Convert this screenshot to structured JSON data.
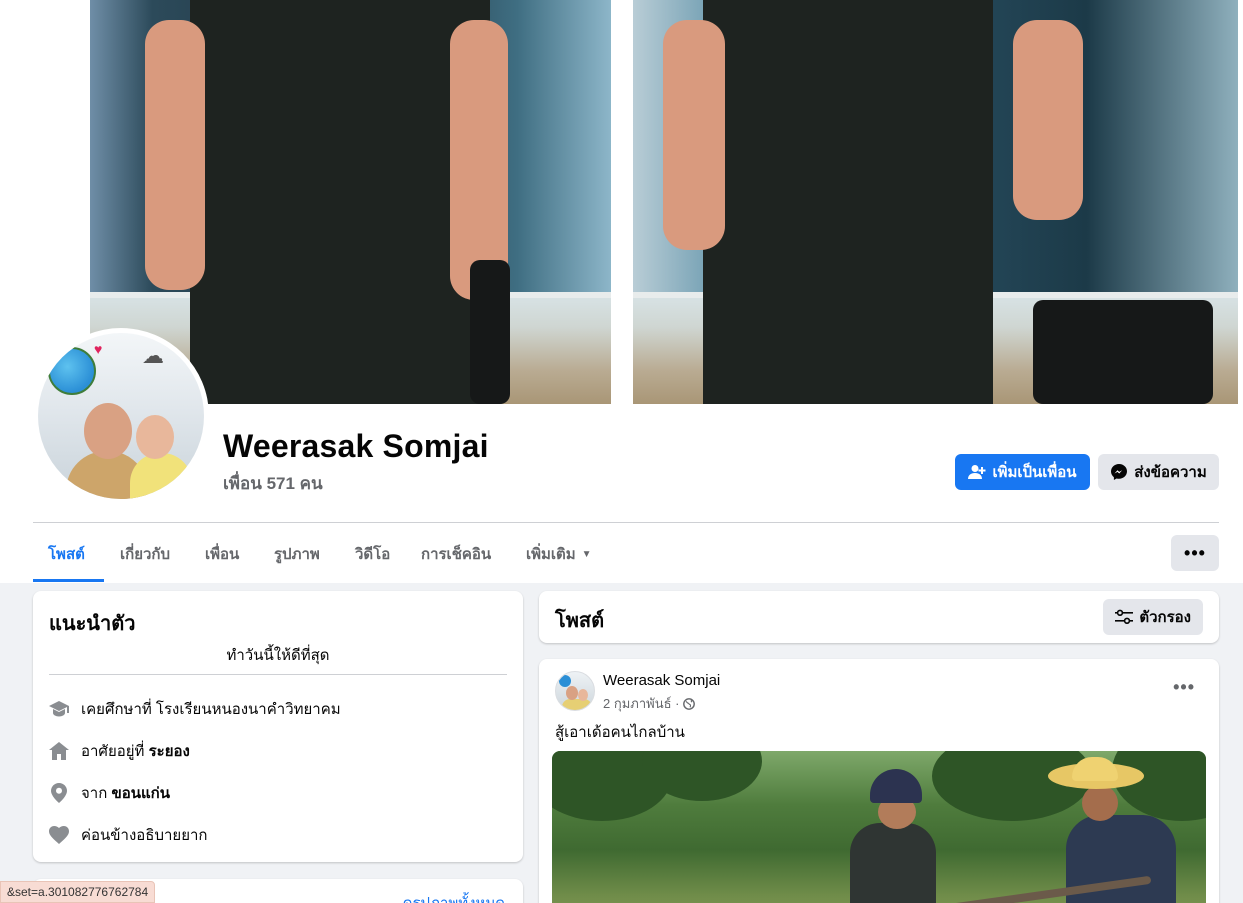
{
  "profile": {
    "name": "Weerasak Somjai",
    "friends": "เพื่อน 571 คน"
  },
  "actions": {
    "add_friend": "เพิ่มเป็นเพื่อน",
    "message": "ส่งข้อความ",
    "more": "•••"
  },
  "tabs": [
    {
      "label": "โพสต์",
      "active": true
    },
    {
      "label": "เกี่ยวกับ"
    },
    {
      "label": "เพื่อน"
    },
    {
      "label": "รูปภาพ"
    },
    {
      "label": "วิดีโอ"
    },
    {
      "label": "การเช็คอิน"
    },
    {
      "label": "เพิ่มเติม"
    }
  ],
  "intro": {
    "title": "แนะนำตัว",
    "bio": "ทำวันนี้ให้ดีที่สุด",
    "rows": [
      {
        "icon": "graduation-cap-icon",
        "prefix": "เคยศึกษาที่ โรงเรียนหนองนาคำวิทยาคม",
        "bold": ""
      },
      {
        "icon": "home-icon",
        "prefix": "อาศัยอยู่ที่ ",
        "bold": "ระยอง"
      },
      {
        "icon": "location-pin-icon",
        "prefix": "จาก ",
        "bold": "ขอนแก่น"
      },
      {
        "icon": "heart-icon",
        "prefix": "ค่อนข้างอธิบายยาก",
        "bold": ""
      }
    ]
  },
  "photos_card": {
    "link": "ดูรูปภาพทั้งหมด"
  },
  "posts": {
    "title": "โพสต์",
    "filter": "ตัวกรอง"
  },
  "post": {
    "author": "Weerasak Somjai",
    "date": "2 กุมภาพันธ์ ·",
    "privacy_icon": "globe-icon",
    "text": "สู้เอาเด้อคนไกลบ้าน",
    "menu": "•••"
  },
  "status_url": "&set=a.301082776762784",
  "colors": {
    "accent": "#1877f2",
    "background": "#f0f2f5",
    "secondary_text": "#65676b"
  }
}
